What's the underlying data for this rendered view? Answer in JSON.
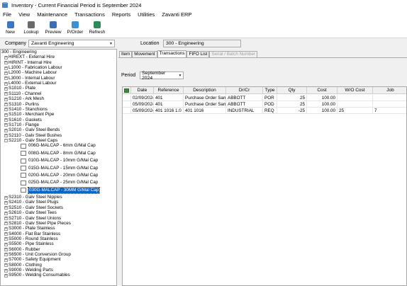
{
  "window": {
    "title": "Inventory - Current Financial Period is September 2024"
  },
  "menu": [
    "File",
    "View",
    "Maintenance",
    "Transactions",
    "Reports",
    "Utilities",
    "Zavanti ERP"
  ],
  "toolbar": [
    {
      "label": "New",
      "icon": "new-icon",
      "color": "#3b78c3"
    },
    {
      "label": "Lookup",
      "icon": "lookup-icon",
      "color": "#6a6a6a"
    },
    {
      "label": "Preview",
      "icon": "preview-icon",
      "color": "#3b6fb5"
    },
    {
      "label": "P/Order",
      "icon": "purchase-order-icon",
      "color": "#3d8fd0"
    },
    {
      "label": "Refresh",
      "icon": "refresh-icon",
      "color": "#2e8b57"
    }
  ],
  "company": {
    "label": "Company",
    "value": "Zavanti Engineering"
  },
  "location": {
    "label": "Location",
    "value": "300 - Engineering"
  },
  "tree": {
    "root": "300 - Engineering",
    "groups_before": [
      "HIREXT - External Hire",
      "HIRINT - Internal Hire",
      "L1000 - Fabrication Labour",
      "L2000 - Machine Labour",
      "L3000 - Internal Labour",
      "L4000 - External Labour",
      "S1010 - Plate",
      "S1110 - Channel",
      "S1210 - Ark Mesh",
      "S1310 - Purlins",
      "S1410 - Stanchions",
      "S1510 - Merchant Pipe",
      "S1610 - Gaskets",
      "S1710 - Flange",
      "S2010 - Galv Steel Bends",
      "S2110 - Galv Steel Bushes"
    ],
    "expanded_group": "S2210 - Galv Steel Caps",
    "children": [
      "006G-MALCAP - 6mm G/Mal Cap",
      "008G-MALCAP - 8mm G/Mal Cap",
      "010G-MALCAP - 10mm G/Mal Cap",
      "015G-MALCAP - 15mm G/Mal Cap",
      "020G-MALCAP - 20mm G/Mal Cap",
      "025G-MALCAP - 25mm G/Mal Cap",
      "030G-MALCAP - 30MM G/Mal Cap"
    ],
    "selected_child_index": 6,
    "groups_after": [
      "S2310 - Galv Steel Nipples",
      "S2410 - Galv Steel Plugs",
      "S2510 - Galv Steel Sockets",
      "S2610 - Galv Steel Tees",
      "S2710 - Galv Steel Unions",
      "S2810 - Galv Steel Pipe Pieces",
      "S3000 - Plate Stainless",
      "S4000 - Flat Bar Stainless",
      "S5000 - Round Stainless",
      "S5500 - Pipe Stainless",
      "S6000 - Rubber",
      "S6500 - Unit Conversion Group",
      "S7000 - Safety Equipment",
      "S8000 - Clothing",
      "S9000 - Welding Parts",
      "S9500 - Welding Consumables"
    ]
  },
  "tabs": [
    {
      "label": "Item",
      "state": "normal"
    },
    {
      "label": "Movement",
      "state": "normal"
    },
    {
      "label": "Transactions",
      "state": "active"
    },
    {
      "label": "FIFO List",
      "state": "normal"
    },
    {
      "label": "Serial / Batch Number",
      "state": "disabled"
    }
  ],
  "period": {
    "label": "Period",
    "value": "September 2024"
  },
  "grid": {
    "columns": [
      "Date",
      "Reference",
      "Description",
      "Dr/Cr",
      "Type",
      "Qty",
      "Cost",
      "W/O Cost",
      "Job"
    ],
    "rows": [
      [
        "02/09/2024",
        "401",
        "Purchase Order Sample",
        "ABBOTT",
        "POR",
        "25",
        "100.00",
        "",
        ""
      ],
      [
        "05/09/2024",
        "401",
        "Purchase Order Sample",
        "ABBOTT",
        "POD",
        "25",
        "100.00",
        "",
        ""
      ],
      [
        "05/09/2024",
        "401 1016 1.0",
        "401 1016",
        "INDUSTRIAL",
        "REQ",
        "-25",
        "100.00",
        "25",
        "7"
      ]
    ]
  }
}
